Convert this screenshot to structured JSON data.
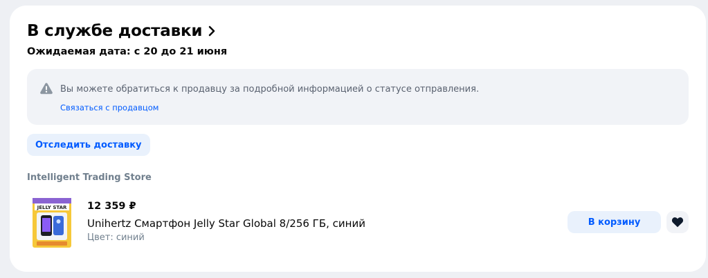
{
  "section": {
    "title": "В службе доставки",
    "expected_date": "Ожидаемая дата: с 20 до 21 июня"
  },
  "info": {
    "text": "Вы можете обратиться к продавцу за подробной информацией о статусе отправления.",
    "link": "Связаться с продавцом"
  },
  "actions": {
    "track_label": "Отследить доставку"
  },
  "store": {
    "name": "Intelligent Trading Store"
  },
  "product": {
    "price": "12 359 ₽",
    "name": "Unihertz Смартфон Jelly Star Global 8/256 ГБ, синий",
    "color": "Цвет: синий",
    "image_label": "JELLY STAR",
    "add_to_cart_label": "В корзину"
  },
  "colors": {
    "accent": "#005bff",
    "accent_bg": "#e9f1fc",
    "muted": "#707f8d"
  }
}
